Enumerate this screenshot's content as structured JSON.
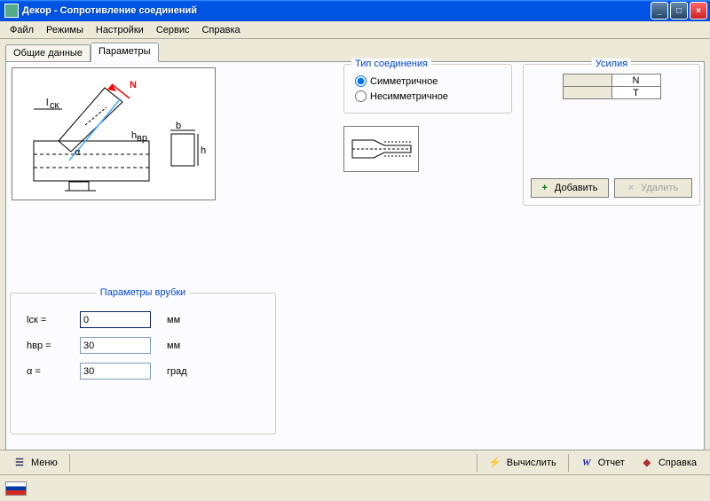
{
  "window": {
    "title": "Декор - Сопротивление соединений"
  },
  "menu": {
    "file": "Файл",
    "modes": "Режимы",
    "settings": "Настройки",
    "service": "Сервис",
    "help": "Справка"
  },
  "tabs": {
    "general": "Общие данные",
    "params": "Параметры"
  },
  "connection": {
    "legend": "Тип соединения",
    "symmetric": "Симметричное",
    "asymmetric": "Несимметричное",
    "selected": "symmetric"
  },
  "forces": {
    "legend": "Усилия",
    "headers": [
      "N",
      "T"
    ],
    "add": "Добавить",
    "remove": "Удалить"
  },
  "notch": {
    "legend": "Параметры врубки",
    "rows": [
      {
        "label": "lск =",
        "value": "0",
        "unit": "мм"
      },
      {
        "label": "hвр =",
        "value": "30",
        "unit": "мм"
      },
      {
        "label": "α =",
        "value": "30",
        "unit": "град"
      }
    ]
  },
  "toolbar": {
    "menu": "Меню",
    "calc": "Вычислить",
    "report": "Отчет",
    "help": "Справка"
  }
}
